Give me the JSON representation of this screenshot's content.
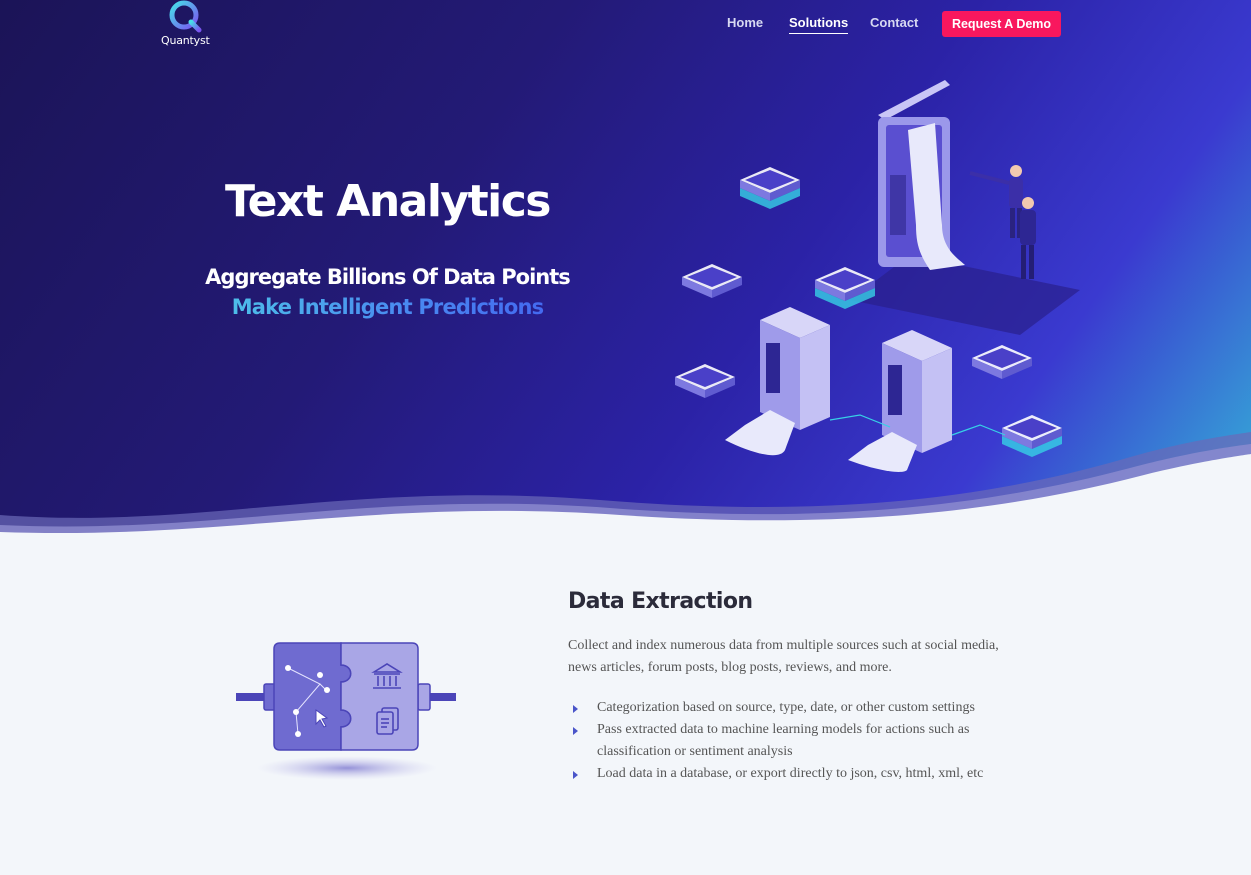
{
  "brand": {
    "name": "Quantyst",
    "logo_icon": "search-magnifier-logo"
  },
  "nav": {
    "items": [
      {
        "label": "Home",
        "active": false
      },
      {
        "label": "Solutions",
        "active": true
      },
      {
        "label": "Contact",
        "active": false
      }
    ],
    "cta_label": "Request A Demo"
  },
  "hero": {
    "title": "Text Analytics",
    "subtitle_line1": "Aggregate Billions Of Data Points",
    "subtitle_line2": "Make Intelligent Predictions",
    "illustration": "isometric-servers-and-data-illustration"
  },
  "section": {
    "title": "Data Extraction",
    "description": "Collect and index numerous data from multiple sources such at social media, news articles, forum posts, blog posts, reviews, and more.",
    "bullets": [
      "Categorization based on source, type, date, or other custom settings",
      "Pass extracted data  to machine learning models for actions such as classification or sentiment analysis",
      "Load data in a database, or export directly to json, csv, html, xml, etc"
    ],
    "illustration": "puzzle-data-connector-icon"
  },
  "colors": {
    "hero_dark": "#1b1457",
    "hero_mid": "#2b22a6",
    "hero_accent": "#35b6d8",
    "cta": "#f8175e",
    "page_bg": "#f3f6fa",
    "bullet_arrow": "#4a55c9"
  }
}
